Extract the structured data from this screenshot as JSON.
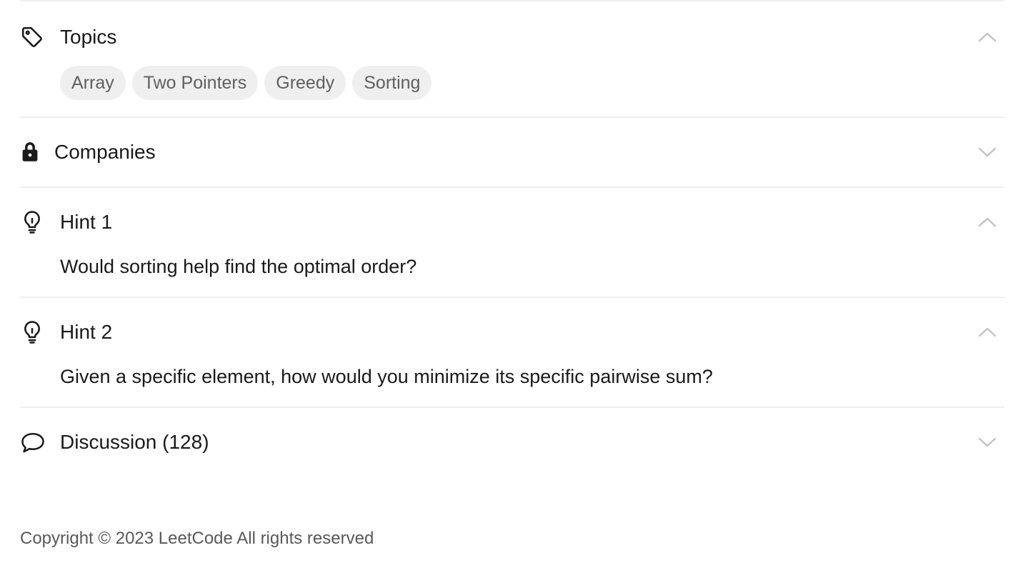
{
  "topics": {
    "title": "Topics",
    "icon": "tag-icon",
    "expanded": true,
    "tags": [
      "Array",
      "Two Pointers",
      "Greedy",
      "Sorting"
    ]
  },
  "companies": {
    "title": "Companies",
    "icon": "lock-icon",
    "expanded": false
  },
  "hints": [
    {
      "title": "Hint 1",
      "icon": "lightbulb-icon",
      "expanded": true,
      "text": "Would sorting help find the optimal order?"
    },
    {
      "title": "Hint 2",
      "icon": "lightbulb-icon",
      "expanded": true,
      "text": "Given a specific element, how would you minimize its specific pairwise sum?"
    }
  ],
  "discussion": {
    "title": "Discussion (128)",
    "icon": "speech-bubble-icon",
    "expanded": false
  },
  "footer": {
    "copyright": "Copyright © 2023 LeetCode All rights reserved"
  },
  "colors": {
    "divider": "#efefef",
    "tag_bg": "#efefef",
    "tag_text": "#5f5f5f",
    "chevron": "#c4c4c4",
    "footer_text": "#595959"
  }
}
